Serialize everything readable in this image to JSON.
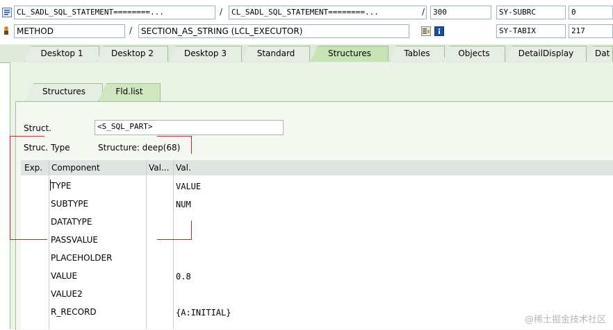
{
  "header": {
    "row1": {
      "program": "CL_SADL_SQL_STATEMENT========...",
      "include": "CL_SADL_SQL_STATEMENT========...",
      "line": "300",
      "sysvar_name": "SY-SUBRC",
      "sysvar_value": "0"
    },
    "row2": {
      "event_type": "METHOD",
      "event": "SECTION_AS_STRING (LCL_EXECUTOR)",
      "sysvar_name": "SY-TABIX",
      "sysvar_value": "217"
    },
    "separator": "/"
  },
  "tabs": [
    {
      "label": "Desktop 1"
    },
    {
      "label": "Desktop 2"
    },
    {
      "label": "Desktop 3"
    },
    {
      "label": "Standard"
    },
    {
      "label": "Structures"
    },
    {
      "label": "Tables"
    },
    {
      "label": "Objects"
    },
    {
      "label": "DetailDisplay"
    },
    {
      "label": "Dat"
    }
  ],
  "subtabs": [
    {
      "label": "Structures"
    },
    {
      "label": "Fld.list"
    }
  ],
  "struct": {
    "label": "Struct.",
    "value": "<S_SQL_PART>",
    "type_label": "Struc. Type",
    "type_value": "Structure: deep(68)"
  },
  "grid": {
    "columns": [
      "Exp.",
      "Component",
      "Val...",
      "Val."
    ],
    "rows": [
      {
        "component": "TYPE",
        "value": "VALUE"
      },
      {
        "component": "SUBTYPE",
        "value": "NUM"
      },
      {
        "component": "DATATYPE",
        "value": ""
      },
      {
        "component": "PASSVALUE",
        "value": ""
      },
      {
        "component": "PLACEHOLDER",
        "value": ""
      },
      {
        "component": "VALUE",
        "value": "0.8"
      },
      {
        "component": "VALUE2",
        "value": ""
      },
      {
        "component": "R_RECORD",
        "value": "{A:INITIAL}"
      }
    ]
  },
  "watermark": "@稀土掘金技术社区",
  "colors": {
    "tab_active": "#c8e4b6",
    "panel": "#eaf3e6",
    "annotation": "#d02020"
  }
}
